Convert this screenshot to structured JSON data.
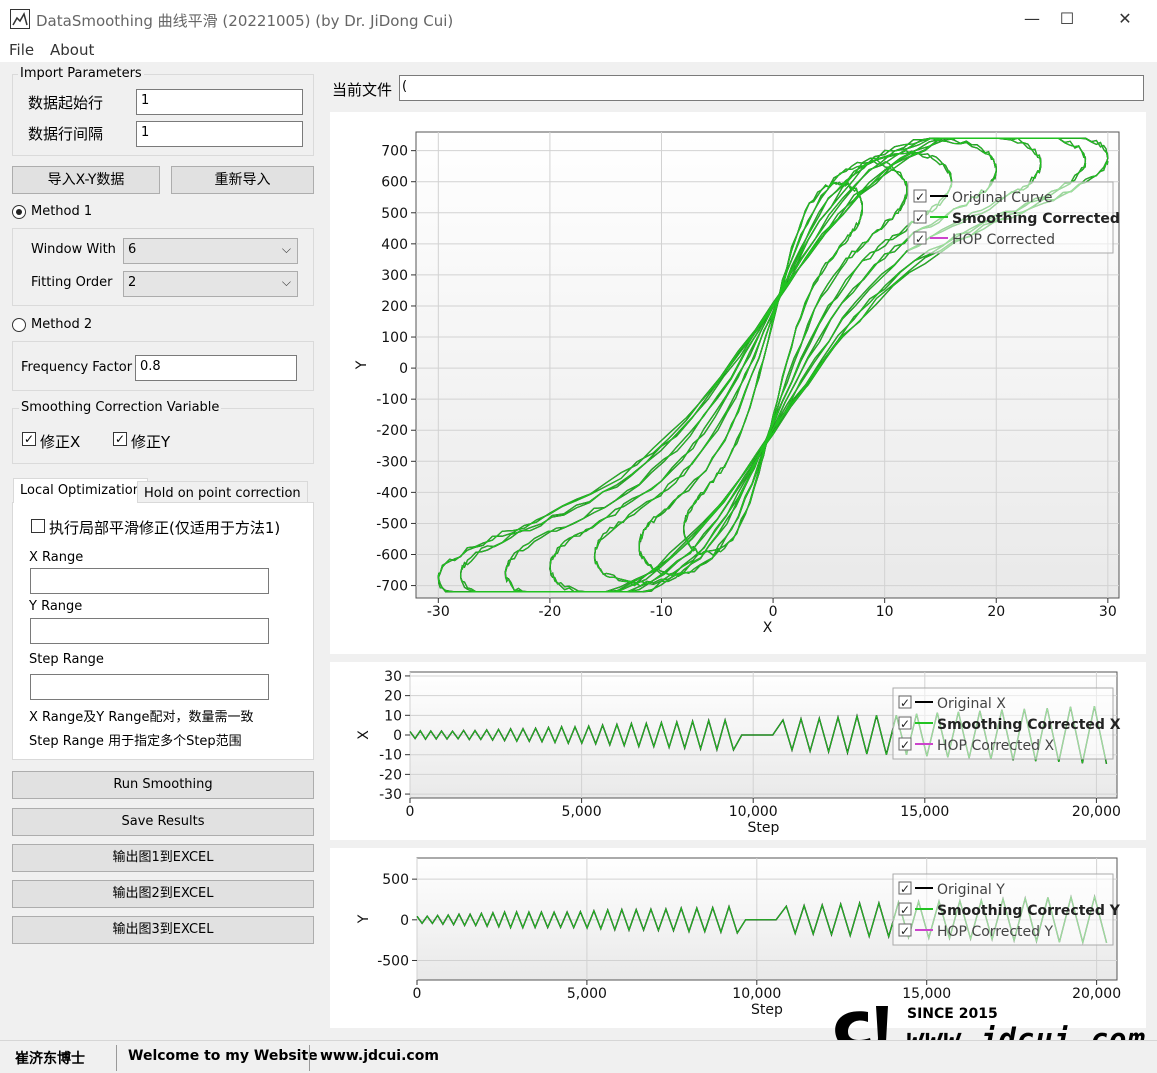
{
  "window": {
    "title": "DataSmoothing 曲线平滑 (20221005) (by Dr. JiDong Cui)",
    "minimize": "—",
    "maximize": "☐",
    "close": "✕"
  },
  "menu": {
    "file": "File",
    "about": "About"
  },
  "import_params": {
    "title": "Import Parameters",
    "start_row_label": "数据起始行",
    "start_row_value": "1",
    "row_interval_label": "数据行间隔",
    "row_interval_value": "1"
  },
  "buttons": {
    "import_xy": "导入X-Y数据",
    "reimport": "重新导入",
    "run_smoothing": "Run Smoothing",
    "save_results": "Save Results",
    "export1": "输出图1到EXCEL",
    "export2": "输出图2到EXCEL",
    "export3": "输出图3到EXCEL"
  },
  "method1": {
    "label": "Method 1",
    "selected": true,
    "window_width_label": "Window With",
    "window_width_value": "6",
    "fitting_order_label": "Fitting Order",
    "fitting_order_value": "2"
  },
  "method2": {
    "label": "Method 2",
    "selected": false,
    "frequency_factor_label": "Frequency Factor",
    "frequency_factor_value": "0.8"
  },
  "smoothing_var": {
    "title": "Smoothing Correction Variable",
    "correct_x": "修正X",
    "correct_y": "修正Y"
  },
  "tabs": {
    "local": "Local Optimization",
    "hold": "Hold on point correction"
  },
  "local_opt": {
    "local_checkbox": "执行局部平滑修正(仅适用于方法1)",
    "x_range_label": "X Range",
    "y_range_label": "Y Range",
    "step_range_label": "Step Range",
    "note1": "X Range及Y Range配对，数量需一致",
    "note2": "Step Range 用于指定多个Step范围"
  },
  "current_file": {
    "label": "当前文件",
    "value": "("
  },
  "colors": {
    "original": "#000000",
    "smoothing": "#22c322",
    "hop": "#cc44cc"
  },
  "icons": {
    "check": "✓",
    "dropdown": "chevron-down-icon"
  },
  "chart_data": [
    {
      "type": "line",
      "xlabel": "X",
      "ylabel": "Y",
      "xlim": [
        -32,
        31
      ],
      "ylim": [
        -740,
        760
      ],
      "xticks": [
        -30,
        -20,
        -10,
        0,
        10,
        20,
        30
      ],
      "yticks": [
        700,
        600,
        500,
        400,
        300,
        200,
        100,
        0,
        -100,
        -200,
        -300,
        -400,
        -500,
        -600,
        -700
      ],
      "grid": true,
      "legend_position": "top-right",
      "series": [
        {
          "name": "Original Curve",
          "color": "#000000"
        },
        {
          "name": "Smoothing Corrected",
          "color": "#22c322"
        },
        {
          "name": "HOP Corrected",
          "color": "#cc44cc"
        }
      ],
      "amplitudes_x": [
        8,
        12,
        16,
        20,
        24,
        28,
        30
      ],
      "amplitudes_y": [
        560,
        620,
        650,
        690,
        710,
        720,
        730
      ]
    },
    {
      "type": "line",
      "xlabel": "Step",
      "ylabel": "X",
      "xlim": [
        0,
        20600
      ],
      "ylim": [
        -32,
        32
      ],
      "xticks": [
        0,
        5000,
        10000,
        15000,
        20000
      ],
      "xtick_labels": [
        "0",
        "5,000",
        "10,000",
        "15,000",
        "20,000"
      ],
      "yticks": [
        30,
        20,
        10,
        0,
        -10,
        -20,
        -30
      ],
      "grid": true,
      "legend_position": "top-right",
      "series": [
        {
          "name": "Original X",
          "color": "#000000"
        },
        {
          "name": "Smoothing Corrected X",
          "color": "#22c322"
        },
        {
          "name": "HOP Corrected X",
          "color": "#cc44cc"
        }
      ]
    },
    {
      "type": "line",
      "xlabel": "Step",
      "ylabel": "Y",
      "xlim": [
        0,
        20600
      ],
      "ylim": [
        -740,
        760
      ],
      "xticks": [
        0,
        5000,
        10000,
        15000,
        20000
      ],
      "xtick_labels": [
        "0",
        "5,000",
        "10,000",
        "15,000",
        "20,000"
      ],
      "yticks": [
        500,
        0,
        -500
      ],
      "grid": true,
      "legend_position": "top-right",
      "series": [
        {
          "name": "Original Y",
          "color": "#000000"
        },
        {
          "name": "Smoothing Corrected Y",
          "color": "#22c322"
        },
        {
          "name": "HOP Corrected Y",
          "color": "#cc44cc"
        }
      ]
    }
  ],
  "status": {
    "author": "崔济东博士",
    "welcome": "Welcome to my Website",
    "url": "www.jdcui.com"
  },
  "watermark": {
    "since": "SINCE 2015",
    "site": "www.jdcui.com"
  }
}
